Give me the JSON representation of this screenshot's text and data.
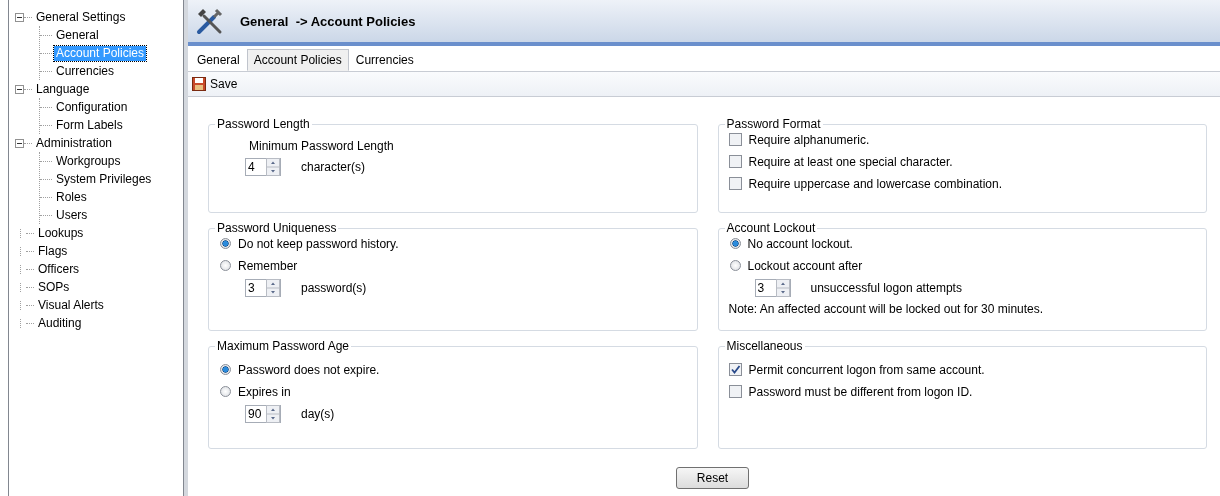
{
  "sidebar": {
    "tree": [
      {
        "label": "General Settings",
        "expanded": true,
        "selected": false,
        "children": [
          {
            "label": "General",
            "selected": false
          },
          {
            "label": "Account Policies",
            "selected": true
          },
          {
            "label": "Currencies",
            "selected": false
          }
        ]
      },
      {
        "label": "Language",
        "expanded": true,
        "selected": false,
        "children": [
          {
            "label": "Configuration",
            "selected": false
          },
          {
            "label": "Form Labels",
            "selected": false
          }
        ]
      },
      {
        "label": "Administration",
        "expanded": true,
        "selected": false,
        "children": [
          {
            "label": "Workgroups",
            "selected": false
          },
          {
            "label": "System Privileges",
            "selected": false
          },
          {
            "label": "Roles",
            "selected": false
          },
          {
            "label": "Users",
            "selected": false
          }
        ]
      },
      {
        "label": "Lookups",
        "selected": false
      },
      {
        "label": "Flags",
        "selected": false
      },
      {
        "label": "Officers",
        "selected": false
      },
      {
        "label": "SOPs",
        "selected": false
      },
      {
        "label": "Visual Alerts",
        "selected": false
      },
      {
        "label": "Auditing",
        "selected": false
      }
    ]
  },
  "header": {
    "title": "General  -> Account Policies"
  },
  "tabs": [
    {
      "label": "General",
      "selected": false
    },
    {
      "label": "Account Policies",
      "selected": true
    },
    {
      "label": "Currencies",
      "selected": false
    }
  ],
  "toolbar": {
    "save": "Save"
  },
  "groups": [
    {
      "title": "Password Length",
      "items": [
        {
          "kind": "label",
          "text": "Minimum Password Length"
        },
        {
          "kind": "spinner",
          "value": "4",
          "unit": "character(s)"
        }
      ]
    },
    {
      "title": "Password Format",
      "items": [
        {
          "kind": "checkbox",
          "label": "Require alphanumeric.",
          "checked": false
        },
        {
          "kind": "checkbox",
          "label": "Require at least one special character.",
          "checked": false
        },
        {
          "kind": "checkbox",
          "label": "Require uppercase and lowercase combination.",
          "checked": false
        }
      ]
    },
    {
      "title": "Password Uniqueness",
      "items": [
        {
          "kind": "radio",
          "label": "Do not keep password history.",
          "selected": true
        },
        {
          "kind": "radio",
          "label": "Remember",
          "selected": false
        },
        {
          "kind": "spinner",
          "value": "3",
          "unit": "password(s)"
        }
      ]
    },
    {
      "title": "Account Lockout",
      "items": [
        {
          "kind": "radio",
          "label": "No account lockout.",
          "selected": true
        },
        {
          "kind": "radio",
          "label": "Lockout account after",
          "selected": false
        },
        {
          "kind": "spinner",
          "value": "3",
          "unit": "unsuccessful logon attempts"
        },
        {
          "kind": "note",
          "text": "Note: An affected account will be locked out for 30 minutes."
        }
      ]
    },
    {
      "title": "Maximum Password Age",
      "items": [
        {
          "kind": "radio",
          "label": "Password does not expire.",
          "selected": true
        },
        {
          "kind": "radio",
          "label": "Expires in",
          "selected": false
        },
        {
          "kind": "spinner",
          "value": "90",
          "unit": "day(s)"
        }
      ]
    },
    {
      "title": "Miscellaneous",
      "items": [
        {
          "kind": "checkbox",
          "label": "Permit concurrent logon from same account.",
          "checked": true
        },
        {
          "kind": "checkbox",
          "label": "Password must be different from logon ID.",
          "checked": false
        }
      ]
    }
  ],
  "reset_button": "Reset"
}
